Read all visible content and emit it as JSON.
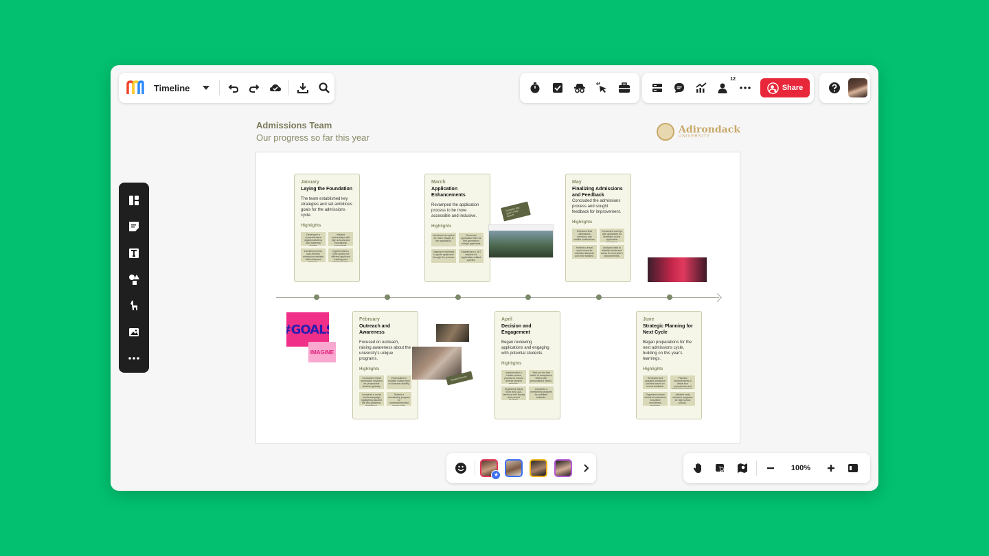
{
  "toolbar": {
    "board_name": "Timeline",
    "share_label": "Share",
    "collaborator_count": "12"
  },
  "board": {
    "title": "Admissions Team",
    "subtitle": "Our progress so far this year",
    "logo_name": "Adirondack",
    "logo_sub": "UNIVERSITY"
  },
  "cards": [
    {
      "month": "January",
      "title": "Laying the Foundation",
      "desc": "The team established key strategies and set ambitious goals for the admissions cycle.",
      "highlights": "Highlights",
      "cells": [
        "Developed a comprehensive digital marketing plan targeting diverse demographics.",
        "Initiated partnerships with high schools and educational consultants.",
        "Launched a new, user-friendly admissions website with enhanced features.",
        "Implemented a CRM system for efficient applicant tracking and communication."
      ]
    },
    {
      "month": "March",
      "title": "Application Enhancements",
      "desc": "Revamped the application process to be more accessible and inclusive.",
      "highlights": "Highlights",
      "cells": [
        "Introduced an option for video essays in the application.",
        "Removed application fees for first-generation college applicants.",
        "Organized webinars to guide applicants through the process.",
        "Established a 24/7 helpline for application-related queries."
      ]
    },
    {
      "month": "May",
      "title": "Finalizing Admissions and Feedback",
      "desc": "Concluded the admissions process and sought feedback for improvement.",
      "highlights": "Highlights",
      "cells": [
        "Released final admissions decisions and waitlist notifications.",
        "Conducted surveys with applicants for feedback on the application experience.",
        "Hosted a virtual open house for admitted students and their families.",
        "Analyzed data to identify trends and areas for next year's improvements."
      ]
    },
    {
      "month": "February",
      "title": "Outreach and Awareness",
      "desc": "Focused on outreach, raising awareness about the university's unique programs.",
      "highlights": "Highlights",
      "cells": [
        "Conducted virtual information sessions for prospective students globally.",
        "Participated in multiple college fairs to increase visibility.",
        "Launched a social media campaign highlighting student life and academic excellence.",
        "Started a scholarship program for underrepresented communities."
      ]
    },
    {
      "month": "April",
      "title": "Decision and Engagement",
      "desc": "Began reviewing applications and engaging with potential students.",
      "highlights": "Highlights",
      "cells": [
        "Implemented a holistic review process to ensure diverse student selection.",
        "Sent out the first batch of acceptance letters with personalized videos.",
        "Organized virtual tours and Q&A sessions with faculty and current students.",
        "Launched a mentorship program for admitted students."
      ]
    },
    {
      "month": "June",
      "title": "Strategic Planning for Next Cycle",
      "desc": "Began preparations for the next admissions cycle, building on this year's learnings.",
      "highlights": "Highlights",
      "cells": [
        "Reviewed and updated admission policies based on recent feedback.",
        "Planned improvements in virtual tour experiences and interactive sessions.",
        "Organized a team retreat to brainstorm innovative recruitment strategies.",
        "Initiated early outreach programs for high school juniors."
      ]
    }
  ],
  "stickers": {
    "goals": "#GOALS",
    "imagine": "IMAGINE",
    "tag1": "Consider this year's early launch",
    "tag2": "Student Events"
  },
  "zoom": {
    "level": "100%"
  },
  "colors": {
    "background": "#02c06f",
    "share": "#e8283a"
  }
}
